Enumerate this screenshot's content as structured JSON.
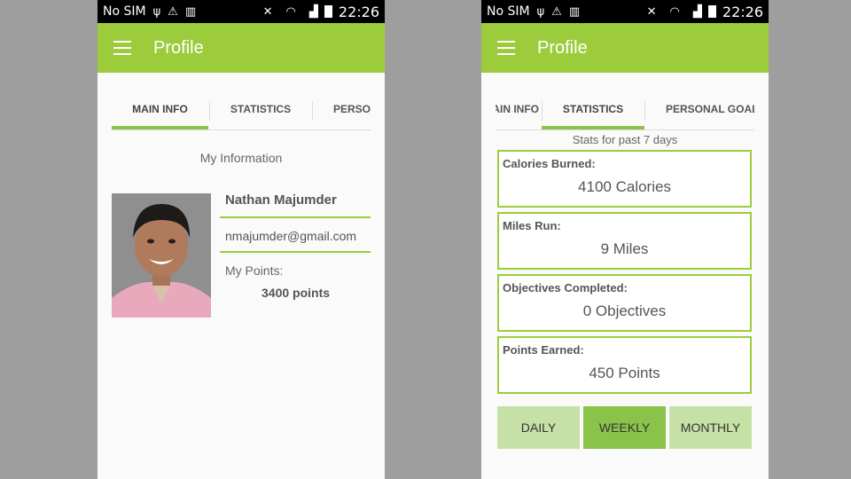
{
  "status_bar": {
    "carrier": "No SIM",
    "time": "22:26"
  },
  "colors": {
    "accent": "#9ccc3c",
    "tab_indicator": "#8bc34a",
    "button_light": "#c5e1a5",
    "button_selected": "#8bc34a"
  },
  "left_screen": {
    "app_title": "Profile",
    "tabs": [
      {
        "label": "MAIN INFO",
        "active": true
      },
      {
        "label": "STATISTICS",
        "active": false
      },
      {
        "label": "PERSONAL GOALS",
        "active": false
      }
    ],
    "section_title": "My Information",
    "user": {
      "name": "Nathan Majumder",
      "email": "nmajumder@gmail.com",
      "points_label": "My Points:",
      "points_value": "3400 points"
    }
  },
  "right_screen": {
    "app_title": "Profile",
    "tabs": [
      {
        "label": "MAIN INFO",
        "active": false
      },
      {
        "label": "STATISTICS",
        "active": true
      },
      {
        "label": "PERSONAL GOALS",
        "active": false
      }
    ],
    "stats_subtitle": "Stats for past 7 days",
    "stats": [
      {
        "label": "Calories Burned:",
        "value": "4100 Calories"
      },
      {
        "label": "Miles Run:",
        "value": "9 Miles"
      },
      {
        "label": "Objectives Completed:",
        "value": "0 Objectives"
      },
      {
        "label": "Points Earned:",
        "value": "450 Points"
      }
    ],
    "period_buttons": [
      {
        "label": "DAILY",
        "selected": false
      },
      {
        "label": "WEEKLY",
        "selected": true
      },
      {
        "label": "MONTHLY",
        "selected": false
      }
    ]
  }
}
